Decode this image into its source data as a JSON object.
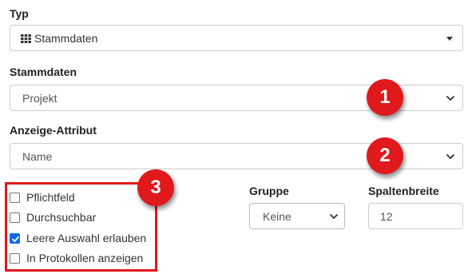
{
  "typ": {
    "label": "Typ",
    "value": "Stammdaten",
    "icon": "grid-icon"
  },
  "stammdaten": {
    "label": "Stammdaten",
    "value": "Projekt"
  },
  "anzeige_attribut": {
    "label": "Anzeige-Attribut",
    "value": "Name"
  },
  "checkboxes": [
    {
      "label": "Pflichtfeld",
      "checked": false
    },
    {
      "label": "Durchsuchbar",
      "checked": false
    },
    {
      "label": "Leere Auswahl erlauben",
      "checked": true
    },
    {
      "label": "In Protokollen anzeigen",
      "checked": false
    }
  ],
  "gruppe": {
    "label": "Gruppe",
    "value": "Keine"
  },
  "spaltenbreite": {
    "label": "Spaltenbreite",
    "value": "12"
  },
  "badges": [
    "1",
    "2",
    "3"
  ],
  "colors": {
    "badge": "#e0191c",
    "checkbox_checked": "#0b6be8"
  }
}
